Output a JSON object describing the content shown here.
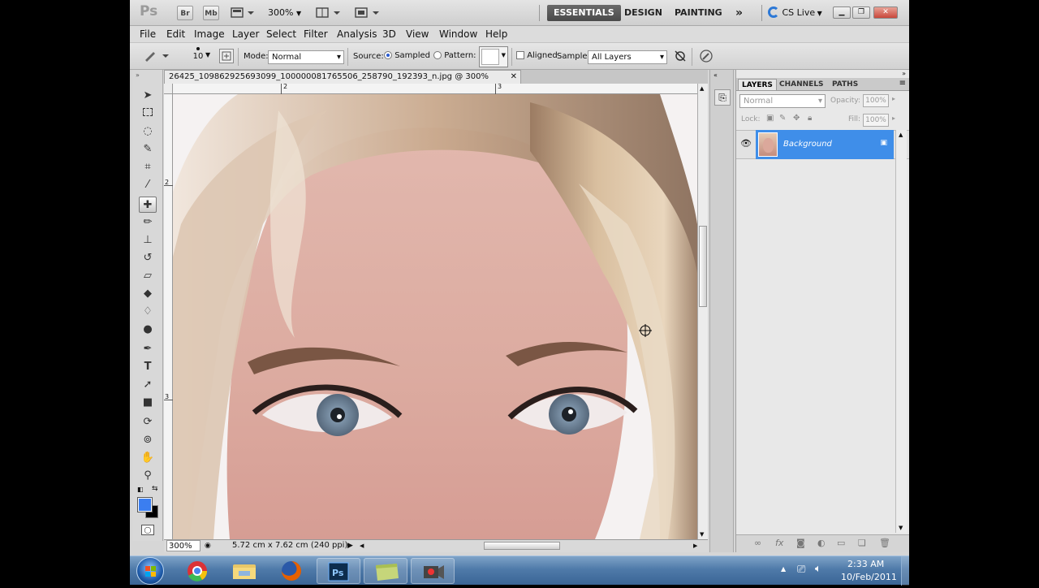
{
  "app": {
    "logo": "Ps",
    "zoom_dropdown": "300%",
    "bridge_btn": "Br",
    "minibridge_btn": "Mb"
  },
  "workspaces": {
    "essentials": "ESSENTIALS",
    "design": "DESIGN",
    "painting": "PAINTING",
    "more": "»"
  },
  "cslive": "CS Live",
  "menus": [
    "File",
    "Edit",
    "Image",
    "Layer",
    "Select",
    "Filter",
    "Analysis",
    "3D",
    "View",
    "Window",
    "Help"
  ],
  "options": {
    "brush_size": "10",
    "mode_label": "Mode:",
    "mode_value": "Normal",
    "source_label": "Source:",
    "sampled_label": "Sampled",
    "pattern_label": "Pattern:",
    "aligned_label": "Aligned",
    "sample_label": "Sample:",
    "sample_value": "All Layers"
  },
  "document": {
    "tab_title": "26425_109862925693099_100000081765506_258790_192393_n.jpg @ 300% (RGB/8) *",
    "ruler_marks_h": [
      "2",
      "3"
    ],
    "ruler_marks_v": [
      "2",
      "3"
    ],
    "status_zoom": "300%",
    "status_info": "5.72 cm x 7.62 cm (240 ppi)"
  },
  "layers_panel": {
    "tabs": [
      "LAYERS",
      "CHANNELS",
      "PATHS"
    ],
    "blend_mode": "Normal",
    "opacity_label": "Opacity:",
    "opacity_value": "100%",
    "lock_label": "Lock:",
    "fill_label": "Fill:",
    "fill_value": "100%",
    "layer_name": "Background"
  },
  "colors": {
    "foreground": "#3b7ef0",
    "background": "#000000",
    "layer_highlight": "#3f8ee9",
    "essentials_bg": "#555555"
  },
  "taskbar": {
    "time": "2:33 AM",
    "date": "10/Feb/2011"
  }
}
